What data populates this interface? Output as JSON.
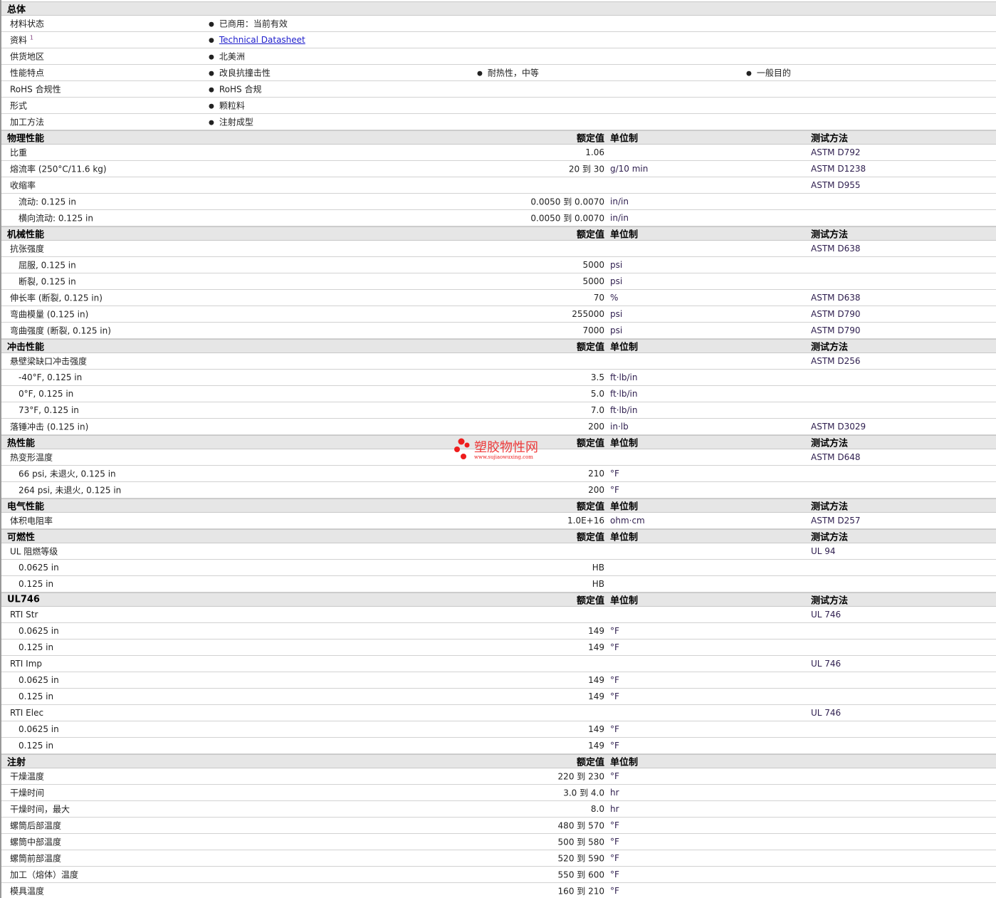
{
  "general": {
    "title": "总体",
    "rows": [
      {
        "label": "材料状态",
        "items": [
          "已商用：当前有效"
        ]
      },
      {
        "label": "资料",
        "sup": "1",
        "items": [
          "Technical Datasheet"
        ],
        "link": true
      },
      {
        "label": "供货地区",
        "items": [
          "北美洲"
        ]
      },
      {
        "label": "性能特点",
        "items": [
          "改良抗撞击性",
          "耐热性，中等",
          "一般目的"
        ]
      },
      {
        "label": "RoHS 合规性",
        "items": [
          "RoHS 合规"
        ]
      },
      {
        "label": "形式",
        "items": [
          "颗粒料"
        ]
      },
      {
        "label": "加工方法",
        "items": [
          "注射成型"
        ]
      }
    ]
  },
  "col_headers": {
    "value": "额定值",
    "unit": "单位制",
    "method": "测试方法"
  },
  "sections": [
    {
      "title": "物理性能",
      "method_col": true,
      "rows": [
        {
          "label": "比重",
          "value": "1.06",
          "unit": "",
          "method": "ASTM D792"
        },
        {
          "label": "熔流率  (250°C/11.6 kg)",
          "value": "20 到  30",
          "unit": "g/10 min",
          "method": "ASTM D1238"
        },
        {
          "label": "收缩率",
          "value": "",
          "unit": "",
          "method": "ASTM D955"
        },
        {
          "label": "流动: 0.125 in",
          "indent": true,
          "value": "0.0050 到  0.0070",
          "unit": "in/in",
          "method": ""
        },
        {
          "label": "横向流动: 0.125 in",
          "indent": true,
          "value": "0.0050 到  0.0070",
          "unit": "in/in",
          "method": ""
        }
      ]
    },
    {
      "title": "机械性能",
      "method_col": true,
      "rows": [
        {
          "label": "抗张强度",
          "value": "",
          "unit": "",
          "method": "ASTM D638"
        },
        {
          "label": "屈服, 0.125 in",
          "indent": true,
          "value": "5000",
          "unit": "psi",
          "method": ""
        },
        {
          "label": "断裂, 0.125 in",
          "indent": true,
          "value": "5000",
          "unit": "psi",
          "method": ""
        },
        {
          "label": "伸长率  (断裂, 0.125 in)",
          "value": "70",
          "unit": "%",
          "method": "ASTM D638"
        },
        {
          "label": "弯曲模量  (0.125 in)",
          "value": "255000",
          "unit": "psi",
          "method": "ASTM D790"
        },
        {
          "label": "弯曲强度  (断裂, 0.125 in)",
          "value": "7000",
          "unit": "psi",
          "method": "ASTM D790"
        }
      ]
    },
    {
      "title": "冲击性能",
      "method_col": true,
      "rows": [
        {
          "label": "悬壁梁缺口冲击强度",
          "value": "",
          "unit": "",
          "method": "ASTM D256"
        },
        {
          "label": "-40°F, 0.125 in",
          "indent": true,
          "value": "3.5",
          "unit": "ft·lb/in",
          "method": ""
        },
        {
          "label": "0°F, 0.125 in",
          "indent": true,
          "value": "5.0",
          "unit": "ft·lb/in",
          "method": ""
        },
        {
          "label": "73°F, 0.125 in",
          "indent": true,
          "value": "7.0",
          "unit": "ft·lb/in",
          "method": ""
        },
        {
          "label": "落锤冲击  (0.125 in)",
          "value": "200",
          "unit": "in·lb",
          "method": "ASTM D3029"
        }
      ]
    },
    {
      "title": "热性能",
      "method_col": true,
      "rows": [
        {
          "label": "热变形温度",
          "value": "",
          "unit": "",
          "method": "ASTM D648"
        },
        {
          "label": "66 psi, 未退火, 0.125 in",
          "indent": true,
          "value": "210",
          "unit": "°F",
          "method": ""
        },
        {
          "label": "264 psi, 未退火, 0.125 in",
          "indent": true,
          "value": "200",
          "unit": "°F",
          "method": ""
        }
      ]
    },
    {
      "title": "电气性能",
      "method_col": true,
      "rows": [
        {
          "label": "体积电阻率",
          "value": "1.0E+16",
          "unit": "ohm·cm",
          "method": "ASTM D257"
        }
      ]
    },
    {
      "title": "可燃性",
      "method_col": true,
      "rows": [
        {
          "label": "UL 阻燃等级",
          "value": "",
          "unit": "",
          "method": "UL 94"
        },
        {
          "label": "0.0625 in",
          "indent": true,
          "value": "HB",
          "unit": "",
          "method": ""
        },
        {
          "label": "0.125 in",
          "indent": true,
          "value": "HB",
          "unit": "",
          "method": ""
        }
      ]
    },
    {
      "title": "UL746",
      "method_col": true,
      "rows": [
        {
          "label": "RTI Str",
          "value": "",
          "unit": "",
          "method": "UL 746"
        },
        {
          "label": "0.0625 in",
          "indent": true,
          "value": "149",
          "unit": "°F",
          "method": ""
        },
        {
          "label": "0.125 in",
          "indent": true,
          "value": "149",
          "unit": "°F",
          "method": ""
        },
        {
          "label": "RTI Imp",
          "value": "",
          "unit": "",
          "method": "UL 746"
        },
        {
          "label": "0.0625 in",
          "indent": true,
          "value": "149",
          "unit": "°F",
          "method": ""
        },
        {
          "label": "0.125 in",
          "indent": true,
          "value": "149",
          "unit": "°F",
          "method": ""
        },
        {
          "label": "RTI Elec",
          "value": "",
          "unit": "",
          "method": "UL 746"
        },
        {
          "label": "0.0625 in",
          "indent": true,
          "value": "149",
          "unit": "°F",
          "method": ""
        },
        {
          "label": "0.125 in",
          "indent": true,
          "value": "149",
          "unit": "°F",
          "method": ""
        }
      ]
    },
    {
      "title": "注射",
      "method_col": false,
      "rows": [
        {
          "label": "干燥温度",
          "value": "220 到  230",
          "unit": "°F",
          "method": ""
        },
        {
          "label": "干燥时间",
          "value": "3.0 到  4.0",
          "unit": "hr",
          "method": ""
        },
        {
          "label": "干燥时间，最大",
          "value": "8.0",
          "unit": "hr",
          "method": ""
        },
        {
          "label": "螺筒后部温度",
          "value": "480 到  570",
          "unit": "°F",
          "method": ""
        },
        {
          "label": "螺筒中部温度",
          "value": "500 到  580",
          "unit": "°F",
          "method": ""
        },
        {
          "label": "螺筒前部温度",
          "value": "520 到  590",
          "unit": "°F",
          "method": ""
        },
        {
          "label": "加工（熔体）温度",
          "value": "550 到  600",
          "unit": "°F",
          "method": ""
        },
        {
          "label": "模具温度",
          "value": "160 到  210",
          "unit": "°F",
          "method": ""
        }
      ]
    }
  ],
  "watermark": {
    "name": "塑胶物性网",
    "url": "www.sujiaowuxing.com",
    "color": "#ee1c1c"
  }
}
